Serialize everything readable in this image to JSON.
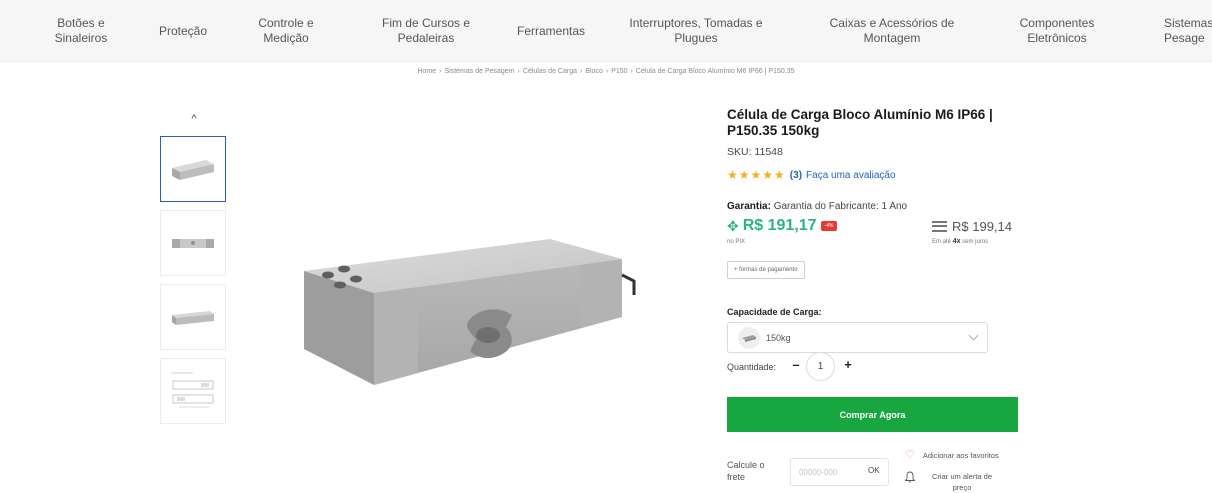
{
  "nav": {
    "items": [
      {
        "label": "Botões e\nSinaleiros"
      },
      {
        "label": "Proteção"
      },
      {
        "label": "Controle e\nMedição"
      },
      {
        "label": "Fim de Cursos e\nPedaleiras"
      },
      {
        "label": "Ferramentas"
      },
      {
        "label": "Interruptores, Tomadas e\nPlugues"
      },
      {
        "label": "Caixas e Acessórios de\nMontagem"
      },
      {
        "label": "Componentes\nEletrônicos"
      },
      {
        "label": "Sistemas\nPesage"
      }
    ]
  },
  "breadcrumb": {
    "items": [
      "Home",
      "Sistemas de Pesagem",
      "Células de Carga",
      "Bloco",
      "P150",
      "Célula de Carga Bloco Alumínio M6 IP66 | P150.35"
    ],
    "separator": "›"
  },
  "gallery": {
    "up_arrow": "^"
  },
  "product": {
    "title": "Célula de Carga Bloco Alumínio M6 IP66 | P150.35 150kg",
    "sku": "SKU: 11548",
    "stars": "★★★★★",
    "rating_value": 5,
    "review_count": "(3)",
    "review_link": "Faça uma avaliação",
    "warranty_label": "Garantia:",
    "warranty_text": "Garantia do Fabricante: 1 Ano",
    "pix_icon": "✥",
    "pix_price": "R$ 191,17",
    "discount": "-4%",
    "pix_label": "no PIX",
    "card_price": "R$ 199,14",
    "installments_prefix": "Em até",
    "installments_count": "4x",
    "installments_suffix": "sem juros",
    "payment_forms": "+ formas de pagamento",
    "capacity_label": "Capacidade de Carga:",
    "capacity_value": "150kg",
    "quantity_label": "Quantidade:",
    "quantity_minus": "–",
    "quantity_value": "1",
    "quantity_plus": "+",
    "buy_button": "Comprar Agora",
    "freight_label": "Calcule o\nfrete",
    "cep_placeholder": "00000-000",
    "ok_label": "OK",
    "favorites_label": "Adicionar aos favoritos",
    "price_alert_label": "Criar um alerta de\npreço"
  },
  "colors": {
    "brand_green": "#17a63f",
    "pix_green": "#2bb28a",
    "link_blue": "#1e63b8",
    "star_yellow": "#f2b01e",
    "discount_red": "#e53935"
  }
}
